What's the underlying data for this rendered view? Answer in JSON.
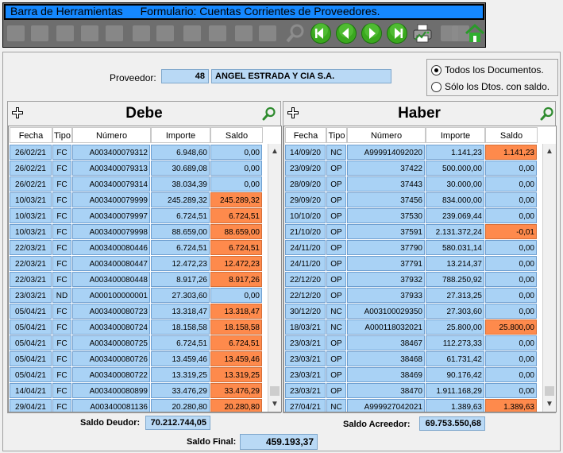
{
  "toolbar": {
    "title": "Barra de Herramientas",
    "form_title": "Formulario: Cuentas Corrientes de Proveedores.",
    "tools": [
      {
        "icon": "first-record-icon",
        "enabled": false
      },
      {
        "icon": "save-icon",
        "enabled": false
      },
      {
        "icon": "save-new-icon",
        "enabled": false
      },
      {
        "icon": "edit-icon",
        "enabled": false
      },
      {
        "icon": "copy-icon",
        "enabled": false
      },
      {
        "icon": "undo-icon",
        "enabled": false
      },
      {
        "icon": "help-icon",
        "enabled": false
      },
      {
        "icon": "film-icon",
        "enabled": false
      },
      {
        "icon": "import-icon",
        "enabled": false
      },
      {
        "icon": "list-icon",
        "enabled": false
      },
      {
        "icon": "grid-list-icon",
        "enabled": false
      },
      {
        "icon": "search-icon",
        "enabled": false
      },
      {
        "icon": "first-icon",
        "enabled": true
      },
      {
        "icon": "previous-icon",
        "enabled": true
      },
      {
        "icon": "next-icon",
        "enabled": true
      },
      {
        "icon": "last-icon",
        "enabled": true
      },
      {
        "icon": "printer-icon",
        "enabled": true
      },
      {
        "icon": "file-icon",
        "enabled": false
      },
      {
        "icon": "open-icon",
        "enabled": false
      },
      {
        "icon": "home-icon",
        "enabled": true
      }
    ]
  },
  "proveedor": {
    "label": "Proveedor:",
    "code": "48",
    "name": "ANGEL ESTRADA Y CIA S.A."
  },
  "filter": {
    "options": [
      {
        "label": "Todos los Documentos.",
        "selected": true
      },
      {
        "label": "Sólo los Dtos. con saldo.",
        "selected": false
      }
    ]
  },
  "debe": {
    "title": "Debe",
    "columns": [
      "Fecha",
      "Tipo",
      "Número",
      "Importe",
      "Saldo"
    ],
    "rows": [
      [
        "26/02/21",
        "FC",
        "A003400079312",
        "6.948,60",
        "0,00",
        false
      ],
      [
        "26/02/21",
        "FC",
        "A003400079313",
        "30.689,08",
        "0,00",
        false
      ],
      [
        "26/02/21",
        "FC",
        "A003400079314",
        "38.034,39",
        "0,00",
        false
      ],
      [
        "10/03/21",
        "FC",
        "A003400079999",
        "245.289,32",
        "245.289,32",
        true
      ],
      [
        "10/03/21",
        "FC",
        "A003400079997",
        "6.724,51",
        "6.724,51",
        true
      ],
      [
        "10/03/21",
        "FC",
        "A003400079998",
        "88.659,00",
        "88.659,00",
        true
      ],
      [
        "22/03/21",
        "FC",
        "A003400080446",
        "6.724,51",
        "6.724,51",
        true
      ],
      [
        "22/03/21",
        "FC",
        "A003400080447",
        "12.472,23",
        "12.472,23",
        true
      ],
      [
        "22/03/21",
        "FC",
        "A003400080448",
        "8.917,26",
        "8.917,26",
        true
      ],
      [
        "23/03/21",
        "ND",
        "A000100000001",
        "27.303,60",
        "0,00",
        false
      ],
      [
        "05/04/21",
        "FC",
        "A003400080723",
        "13.318,47",
        "13.318,47",
        true
      ],
      [
        "05/04/21",
        "FC",
        "A003400080724",
        "18.158,58",
        "18.158,58",
        true
      ],
      [
        "05/04/21",
        "FC",
        "A003400080725",
        "6.724,51",
        "6.724,51",
        true
      ],
      [
        "05/04/21",
        "FC",
        "A003400080726",
        "13.459,46",
        "13.459,46",
        true
      ],
      [
        "05/04/21",
        "FC",
        "A003400080722",
        "13.319,25",
        "13.319,25",
        true
      ],
      [
        "14/04/21",
        "FC",
        "A003400080899",
        "33.476,29",
        "33.476,29",
        true
      ],
      [
        "29/04/21",
        "FC",
        "A003400081136",
        "20.280,80",
        "20.280,80",
        true
      ]
    ]
  },
  "haber": {
    "title": "Haber",
    "columns": [
      "Fecha",
      "Tipo",
      "Número",
      "Importe",
      "Saldo"
    ],
    "rows": [
      [
        "14/09/20",
        "NC",
        "A999914092020",
        "1.141,23",
        "1.141,23",
        true
      ],
      [
        "23/09/20",
        "OP",
        "37422",
        "500.000,00",
        "0,00",
        false
      ],
      [
        "28/09/20",
        "OP",
        "37443",
        "30.000,00",
        "0,00",
        false
      ],
      [
        "29/09/20",
        "OP",
        "37456",
        "834.000,00",
        "0,00",
        false
      ],
      [
        "10/10/20",
        "OP",
        "37530",
        "239.069,44",
        "0,00",
        false
      ],
      [
        "21/10/20",
        "OP",
        "37591",
        "2.131.372,24",
        "-0,01",
        true
      ],
      [
        "24/11/20",
        "OP",
        "37790",
        "580.031,14",
        "0,00",
        false
      ],
      [
        "24/11/20",
        "OP",
        "37791",
        "13.214,37",
        "0,00",
        false
      ],
      [
        "22/12/20",
        "OP",
        "37932",
        "788.250,92",
        "0,00",
        false
      ],
      [
        "22/12/20",
        "OP",
        "37933",
        "27.313,25",
        "0,00",
        false
      ],
      [
        "30/12/20",
        "NC",
        "A003100029350",
        "27.303,60",
        "0,00",
        false
      ],
      [
        "18/03/21",
        "NC",
        "A000118032021",
        "25.800,00",
        "25.800,00",
        true
      ],
      [
        "23/03/21",
        "OP",
        "38467",
        "112.273,33",
        "0,00",
        false
      ],
      [
        "23/03/21",
        "OP",
        "38468",
        "61.731,42",
        "0,00",
        false
      ],
      [
        "23/03/21",
        "OP",
        "38469",
        "90.176,42",
        "0,00",
        false
      ],
      [
        "23/03/21",
        "OP",
        "38470",
        "1.911.168,29",
        "0,00",
        false
      ],
      [
        "27/04/21",
        "NC",
        "A999927042021",
        "1.389,63",
        "1.389,63",
        true
      ]
    ]
  },
  "totals": {
    "saldo_deudor_label": "Saldo Deudor:",
    "saldo_deudor": "70.212.744,05",
    "saldo_acreedor_label": "Saldo Acreedor:",
    "saldo_acreedor": "69.753.550,68",
    "saldo_final_label": "Saldo Final:",
    "saldo_final": "459.193,37"
  },
  "colors": {
    "title_bar": "#1588ff",
    "cell_blue": "#a9d2f5",
    "cell_orange": "#fe8a4c",
    "nav_green": "#3aa81e"
  }
}
